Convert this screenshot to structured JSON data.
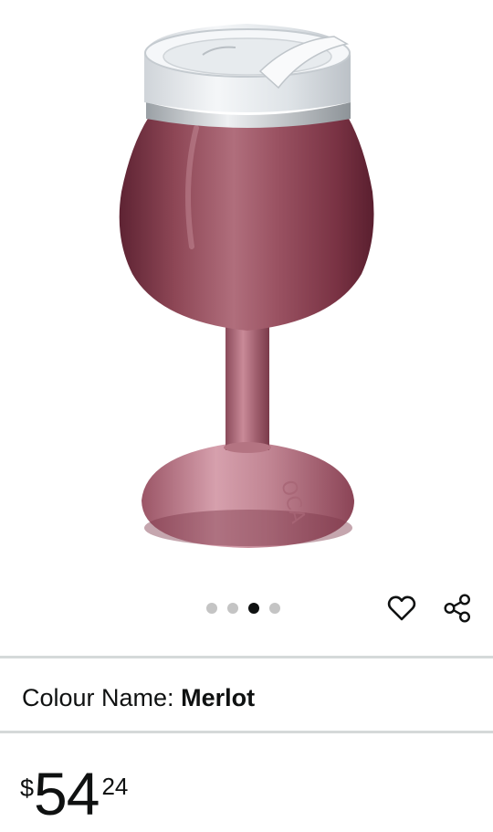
{
  "product": {
    "image_alt": "Merlot stemmed wine tumbler with clear lid",
    "emboss_text": "OCA",
    "colours": {
      "body_dark": "#5e2333",
      "body_mid": "#8e4756",
      "body_light": "#c98a98",
      "lid": "#e6eaee",
      "rim": "#cfd3d6"
    }
  },
  "carousel": {
    "dots": [
      {
        "active": false
      },
      {
        "active": false
      },
      {
        "active": true
      },
      {
        "active": false
      }
    ]
  },
  "actions": {
    "wishlist_icon": "heart-icon",
    "share_icon": "share-icon"
  },
  "colour": {
    "label": "Colour Name:",
    "value": "Merlot"
  },
  "price": {
    "symbol": "$",
    "whole": "54",
    "fraction": "24"
  }
}
